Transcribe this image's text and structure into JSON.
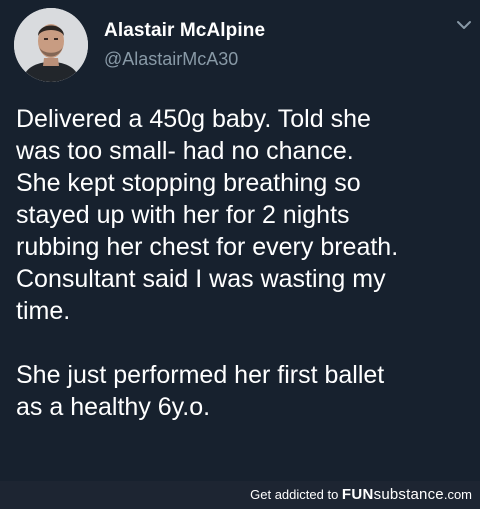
{
  "tweet": {
    "display_name": "Alastair McAlpine",
    "handle": "@AlastairMcA30",
    "avatar_icon": "profile-photo",
    "menu_icon": "chevron-down-icon",
    "text_lines": [
      "Delivered a 450g baby. Told she",
      "was too small- had no chance.",
      "She kept stopping breathing so",
      "stayed up with her for 2 nights",
      "rubbing her chest for every breath.",
      "Consultant said I was wasting my",
      "time.",
      "",
      "She just performed her first ballet",
      "as a healthy 6y.o."
    ]
  },
  "footer": {
    "prefix": "Get addicted to ",
    "brand_fun": "FUN",
    "brand_rest": "substance",
    "brand_suffix": ".com"
  },
  "colors": {
    "background": "#17212e",
    "text_primary": "#ffffff",
    "text_secondary": "#8899a6",
    "footer_background": "#1d2532"
  }
}
